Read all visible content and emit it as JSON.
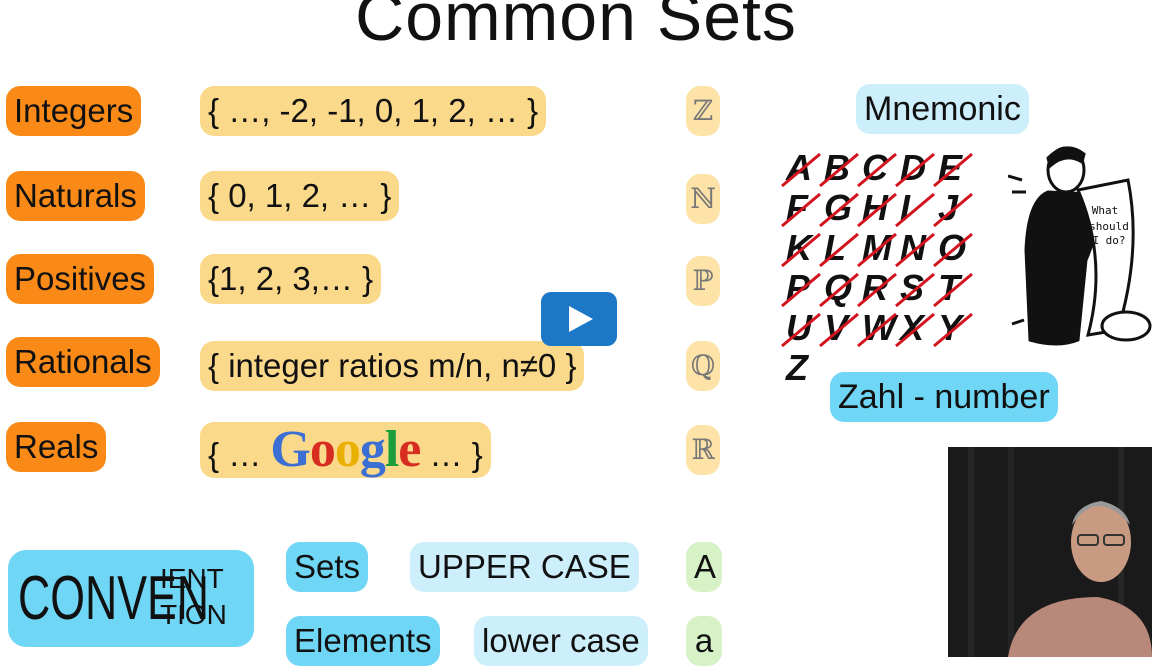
{
  "title": "Common Sets",
  "sets": [
    {
      "name": "Integers",
      "set": "{ …, -2, -1, 0, 1, 2, … }",
      "symbol": "ℤ"
    },
    {
      "name": "Naturals",
      "set": "{ 0, 1, 2, … }",
      "symbol": "ℕ"
    },
    {
      "name": "Positives",
      "set": "{1, 2, 3,… }",
      "symbol": "ℙ"
    },
    {
      "name": "Rationals",
      "set": "{ integer ratios m/n,  n≠0 }",
      "symbol": "ℚ"
    },
    {
      "name": "Reals",
      "set_prefix": "{ …",
      "set_logo": "Google",
      "set_suffix": "… }",
      "symbol": "ℝ"
    }
  ],
  "mnemonic": {
    "label": "Mnemonic",
    "letters": [
      "A",
      "B",
      "C",
      "D",
      "E",
      "F",
      "G",
      "H",
      "I",
      "J",
      "K",
      "L",
      "M",
      "N",
      "O",
      "P",
      "Q",
      "R",
      "S",
      "T",
      "U",
      "V",
      "W",
      "X",
      "Y",
      "Z"
    ],
    "bubble_text": [
      "What",
      "should",
      "I do?"
    ],
    "caption": "Zahl - number"
  },
  "convention": {
    "big": "CONVEN",
    "small_top": "IENT",
    "small_bottom": "TION",
    "rows": [
      {
        "label": "Sets",
        "case": "UPPER CASE",
        "example": "A"
      },
      {
        "label": "Elements",
        "case": "lower case",
        "example": "a"
      }
    ]
  },
  "colors": {
    "orange": "#f98a18",
    "yellow": "#fbd98a",
    "blue": "#6fd6f5",
    "light_blue": "#cdeefb",
    "light_green": "#d8f2c8",
    "play_button": "#1d77c7",
    "strike": "#d2141e"
  },
  "icons": {
    "play": "play-icon",
    "video": "presenter-video-thumbnail",
    "cartoon": "worried-man-with-scroll-illustration"
  }
}
